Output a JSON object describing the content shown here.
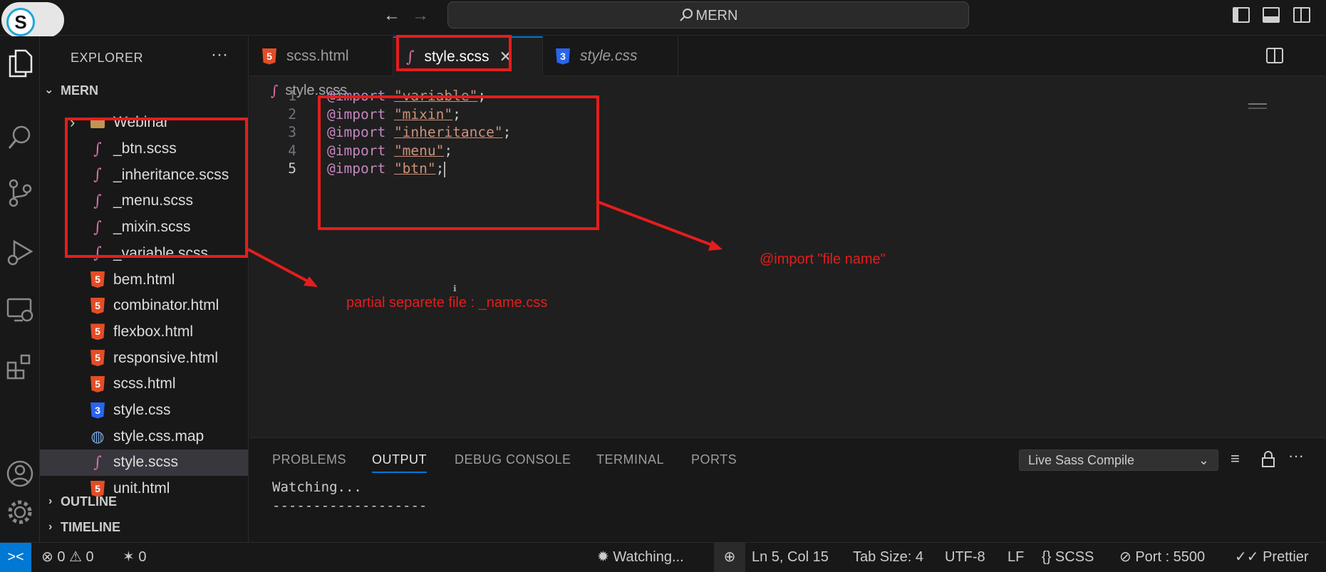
{
  "titlebar": {
    "search_text": "MERN",
    "back_arrow": "←",
    "forward_arrow": "→",
    "logo_letter": "S"
  },
  "explorer": {
    "title": "EXPLORER",
    "more": "···",
    "folder_name": "MERN",
    "files": [
      {
        "name": "Webinar",
        "icon": "folder-icon"
      },
      {
        "name": "_btn.scss",
        "icon": "sass-icon"
      },
      {
        "name": "_inheritance.scss",
        "icon": "sass-icon"
      },
      {
        "name": "_menu.scss",
        "icon": "sass-icon"
      },
      {
        "name": "_mixin.scss",
        "icon": "sass-icon"
      },
      {
        "name": "_variable.scss",
        "icon": "sass-icon"
      },
      {
        "name": "bem.html",
        "icon": "html-icon"
      },
      {
        "name": "combinator.html",
        "icon": "html-icon"
      },
      {
        "name": "flexbox.html",
        "icon": "html-icon"
      },
      {
        "name": "responsive.html",
        "icon": "html-icon"
      },
      {
        "name": "scss.html",
        "icon": "html-icon"
      },
      {
        "name": "style.css",
        "icon": "css-icon"
      },
      {
        "name": "style.css.map",
        "icon": "map-icon"
      },
      {
        "name": "style.scss",
        "icon": "sass-icon",
        "selected": true
      },
      {
        "name": "unit.html",
        "icon": "html-icon"
      }
    ],
    "outline": "OUTLINE",
    "timeline": "TIMELINE"
  },
  "tabs": [
    {
      "label": "scss.html",
      "icon": "html-icon"
    },
    {
      "label": "style.scss",
      "icon": "sass-icon",
      "active": true
    },
    {
      "label": "style.css",
      "icon": "css-icon"
    }
  ],
  "editor": {
    "breadcrumb": "style.scss",
    "lines": [
      {
        "num": "1",
        "kw": "@import",
        "str": "\"variable\"",
        "end": ";"
      },
      {
        "num": "2",
        "kw": "@import",
        "str": "\"mixin\"",
        "end": ";"
      },
      {
        "num": "3",
        "kw": "@import",
        "str": "\"inheritance\"",
        "end": ";"
      },
      {
        "num": "4",
        "kw": "@import",
        "str": "\"menu\"",
        "end": ";"
      },
      {
        "num": "5",
        "kw": "@import",
        "str": "\"btn\"",
        "end": ";"
      }
    ]
  },
  "annotations": {
    "partial": "partial separete file : _name.css",
    "import": "@import \"file name\"",
    "color": "#e51d1d"
  },
  "panel": {
    "tabs": [
      "PROBLEMS",
      "OUTPUT",
      "DEBUG CONSOLE",
      "TERMINAL",
      "PORTS"
    ],
    "active_tab": "OUTPUT",
    "select_value": "Live Sass Compile",
    "output": [
      "Watching...",
      "-------------------"
    ]
  },
  "statusbar": {
    "remote": "><",
    "errors": "0",
    "warnings": "0",
    "ports_count": "0",
    "watching": "Watching...",
    "position": "Ln 5, Col 15",
    "tab_size": "Tab Size: 4",
    "encoding": "UTF-8",
    "eol": "LF",
    "language": "SCSS",
    "port": "Port : 5500",
    "prettier": "Prettier"
  },
  "colors": {
    "accent": "#0078d4",
    "html": "#e44d26",
    "css": "#2965f1",
    "sass": "#d66fa6"
  }
}
